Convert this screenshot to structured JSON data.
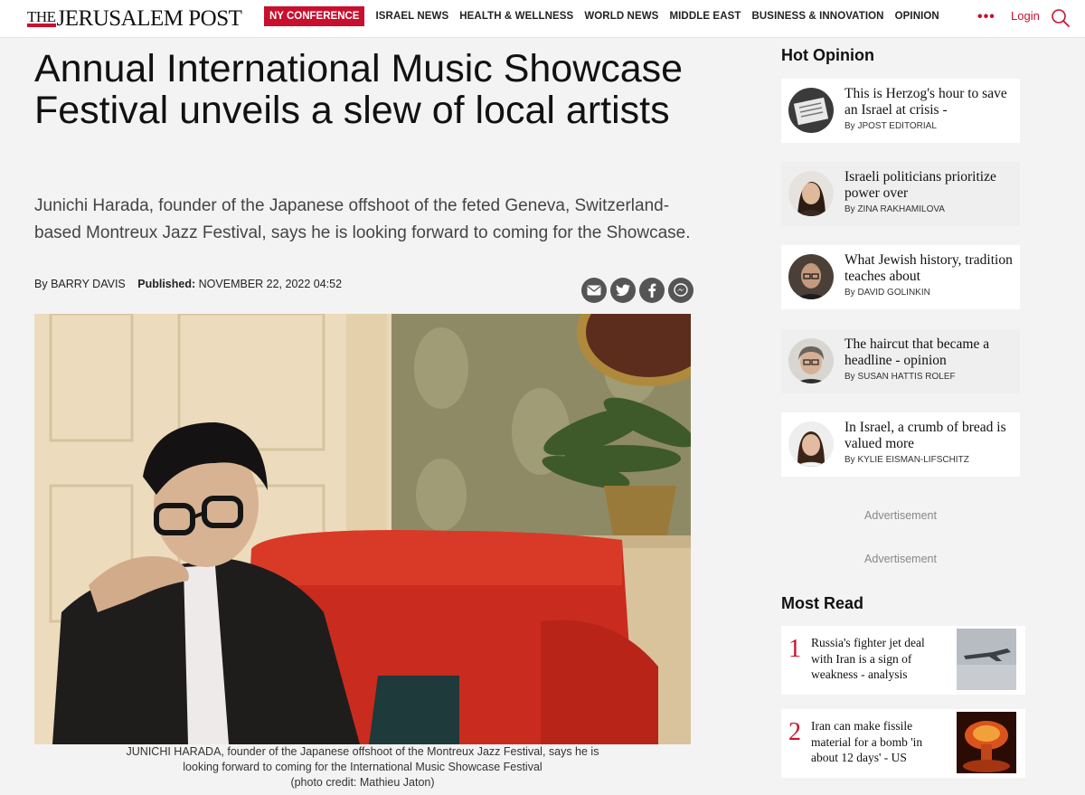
{
  "header": {
    "logo_the": "THE",
    "logo_rest": "JERUSALEM POST",
    "nav_highlight": "NY CONFERENCE",
    "nav": [
      "ISRAEL NEWS",
      "HEALTH & WELLNESS",
      "WORLD NEWS",
      "MIDDLE EAST",
      "BUSINESS & INNOVATION",
      "OPINION"
    ],
    "more": "•••",
    "login": "Login",
    "icons": {
      "search": "search-icon",
      "more": "more-dots-icon"
    },
    "accent_color": "#c8102e"
  },
  "article": {
    "headline": "Annual International Music Showcase Festival unveils a slew of local artists",
    "dek": "Junichi Harada, founder of the Japanese offshoot of the feted Geneva, Switzerland-based Montreux Jazz Festival, says he is looking forward to coming for the Showcase.",
    "byline_prefix": "By",
    "author": "BARRY DAVIS",
    "published_label": "Published:",
    "published_date": "NOVEMBER 22, 2022 04:52",
    "share_icons": [
      "email-icon",
      "twitter-icon",
      "facebook-icon",
      "messenger-icon"
    ],
    "caption_line1": "JUNICHI HARADA, founder of the Japanese offshoot of the Montreux Jazz Festival, says he is",
    "caption_line2": "looking forward to coming for the International Music Showcase Festival",
    "caption_credit": "(photo credit: Mathieu Jaton)"
  },
  "sidebar": {
    "hot_opinion_title": "Hot Opinion",
    "hot_opinion": [
      {
        "title": "This is Herzog's hour to save an Israel at crisis -",
        "author": "By JPOST EDITORIAL"
      },
      {
        "title": "Israeli politicians prioritize power over",
        "author": "By ZINA RAKHAMILOVA"
      },
      {
        "title": "What Jewish history, tradition teaches about",
        "author": "By DAVID GOLINKIN"
      },
      {
        "title": "The haircut that became a headline - opinion",
        "author": "By SUSAN HATTIS ROLEF"
      },
      {
        "title": "In Israel, a crumb of bread is valued more",
        "author": "By KYLIE EISMAN-LIFSCHITZ"
      }
    ],
    "ad_label_1": "Advertisement",
    "ad_label_2": "Advertisement",
    "most_read_title": "Most Read",
    "most_read": [
      {
        "rank": "1",
        "title": "Russia's fighter jet deal with Iran is a sign of weakness - analysis"
      },
      {
        "rank": "2",
        "title": "Iran can make fissile material for a bomb 'in about 12 days' - US"
      }
    ]
  }
}
